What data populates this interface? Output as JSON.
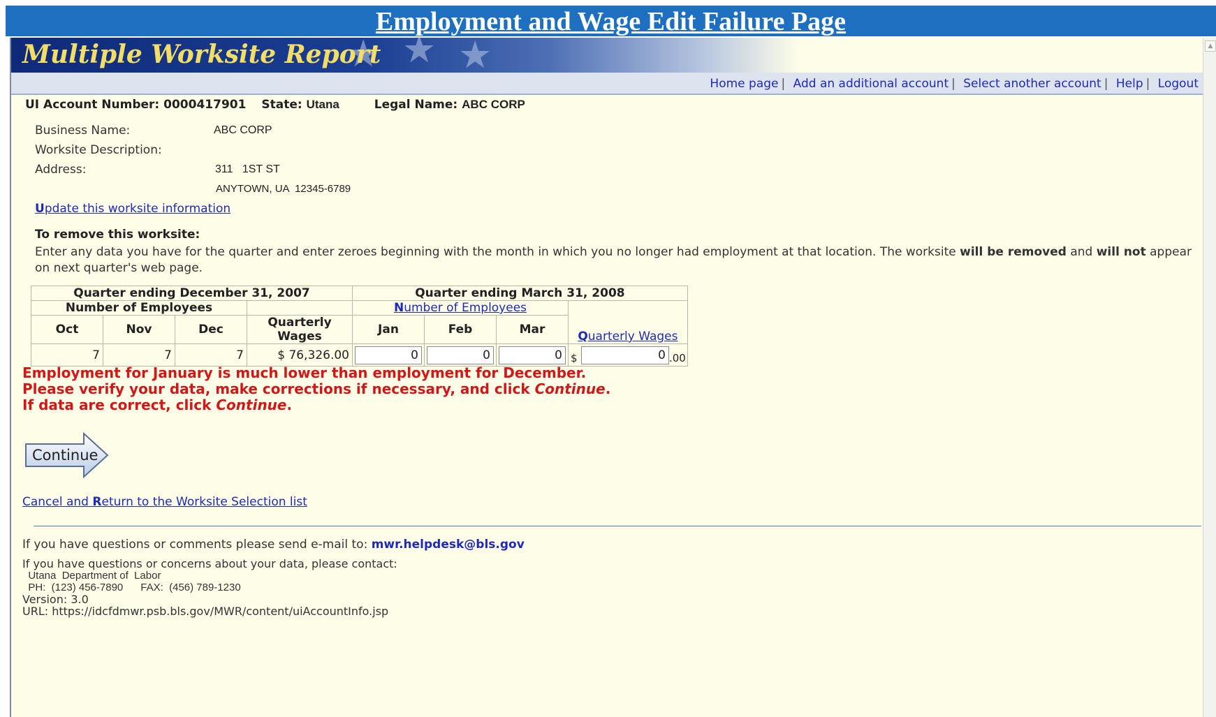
{
  "page_title": "Employment and Wage Edit Failure Page",
  "banner": {
    "title": "Multiple Worksite Report"
  },
  "nav": {
    "home": "Home page",
    "add_account": "Add an additional account",
    "select_account": "Select another account",
    "help": "Help",
    "logout": "Logout",
    "separator": "|"
  },
  "account": {
    "ui_label": "UI Account Number:",
    "ui_value": "0000417901",
    "state_label": "State:",
    "state_value": "Utana",
    "legal_label": "Legal Name:",
    "legal_value": "ABC CORP"
  },
  "worksite": {
    "business_label": "Business Name:",
    "business_value": "ABC CORP",
    "description_label": "Worksite Description:",
    "address_label": "Address:",
    "address_line1": "311   1ST ST",
    "address_line2": "ANYTOWN, UA  12345-6789",
    "update_link_prefix": "U",
    "update_link_rest": "pdate this worksite information"
  },
  "remove": {
    "heading": "To remove this worksite:",
    "text_1": "Enter any data you have for the quarter and enter zeroes beginning with the month in which you no longer had employment at that location. The worksite ",
    "bold_1": "will be removed",
    "text_2": " and ",
    "bold_2": "will not",
    "text_3": " appear on next quarter's web page."
  },
  "table": {
    "prev_quarter": "Quarter ending December 31, 2007",
    "curr_quarter": "Quarter ending March 31, 2008",
    "employees_label": "Number of Employees",
    "employees_link_prefix": "N",
    "employees_link_rest": "umber of Employees",
    "wages_label": "Quarterly Wages",
    "wages_link_prefix": "Q",
    "wages_link_rest": "uarterly Wages",
    "months_prev": [
      "Oct",
      "Nov",
      "Dec"
    ],
    "months_curr": [
      "Jan",
      "Feb",
      "Mar"
    ],
    "prev_values": [
      "7",
      "7",
      "7"
    ],
    "prev_wages": "$ 76,326.00",
    "curr_values": [
      "0",
      "0",
      "0"
    ],
    "curr_wages": "0",
    "dollar": "$",
    "cents": ".00"
  },
  "error": {
    "line1": "Employment for January is much lower than employment for December.",
    "line2_prefix": "Please verify your data, make corrections if necessary, and click ",
    "continue_word": "Continue",
    "period": ".",
    "line3_prefix": "If data are correct, click "
  },
  "continue_button": {
    "label": "Continue"
  },
  "cancel_link": {
    "part1": "Cancel and ",
    "part2": "R",
    "part3": "eturn to the Worksite Selection list"
  },
  "footer": {
    "email_prefix": "If you have questions or comments please send e-mail to: ",
    "email": "mwr.helpdesk@bls.gov",
    "contact_intro": "If you have questions or concerns about your data, please contact:",
    "contact_org": "  Utana  Department of  Labor",
    "contact_phone": "  PH:  (123) 456-7890      FAX:  (456) 789-1230",
    "version": "Version: 3.0",
    "url": "URL: https://idcfdmwr.psb.bls.gov/MWR/content/uiAccountInfo.jsp"
  }
}
